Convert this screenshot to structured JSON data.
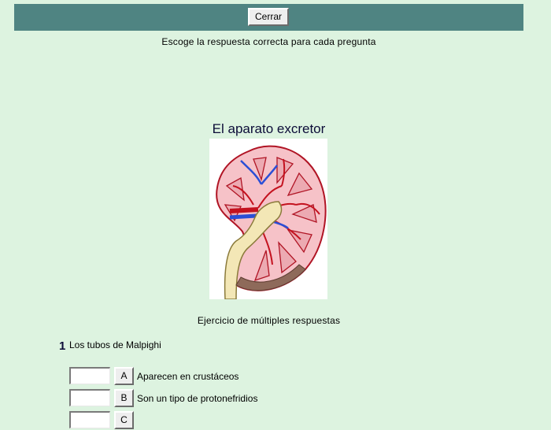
{
  "toolbar": {
    "close_label": "Cerrar"
  },
  "instructions": "Escoge la respuesta correcta para cada pregunta",
  "title": "El aparato excretor",
  "image": {
    "subject": "kidney-cross-section"
  },
  "exercise_label": "Ejercicio de múltiples respuestas",
  "question": {
    "number": "1",
    "text": "Los tubos de Malpighi",
    "options": [
      {
        "letter": "A",
        "text": "Aparecen en crustáceos",
        "answer": ""
      },
      {
        "letter": "B",
        "text": "Son un tipo de protonefridios",
        "answer": ""
      },
      {
        "letter": "C",
        "text": "",
        "answer": ""
      }
    ]
  },
  "colors": {
    "background": "#ddf3e0",
    "topbar": "#4f8482",
    "title": "#0c0c38"
  }
}
